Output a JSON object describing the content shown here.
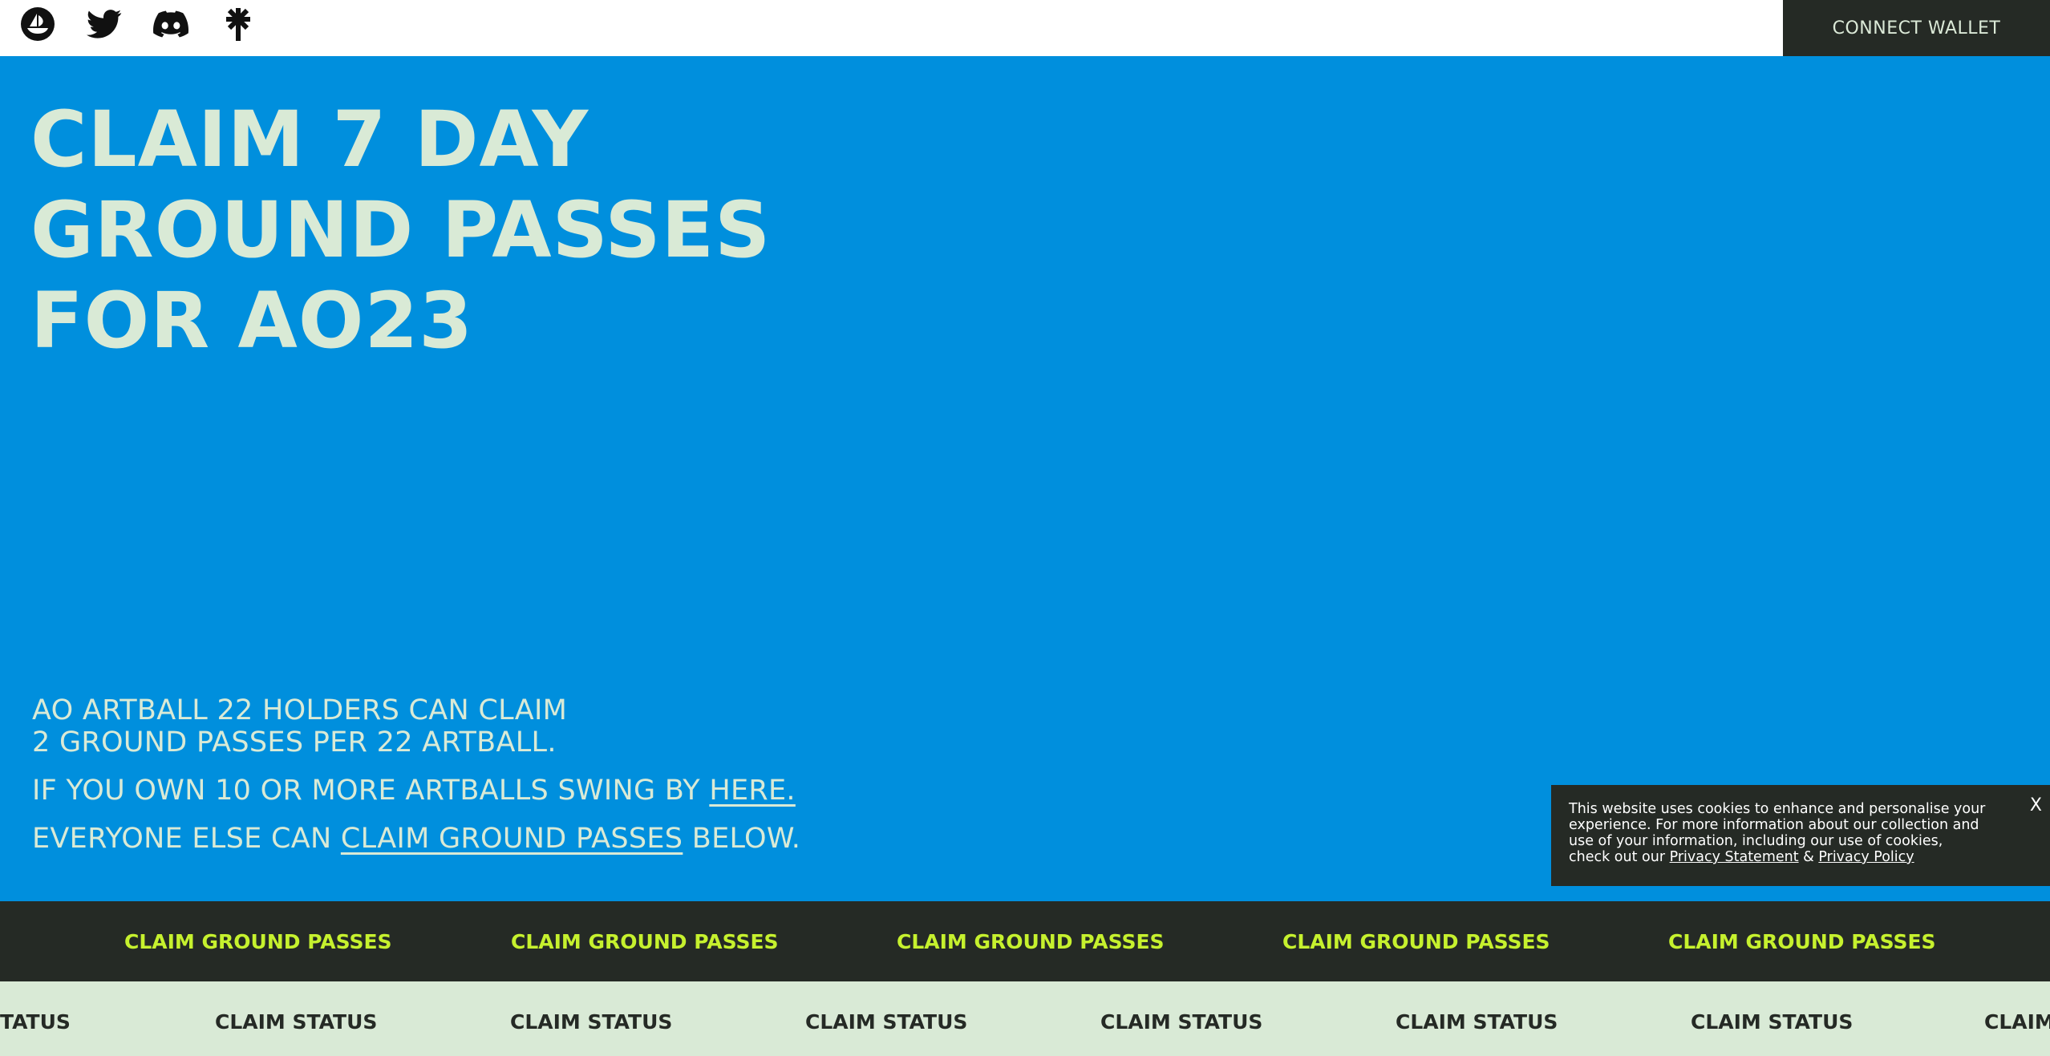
{
  "header": {
    "social_icons": [
      "opensea-icon",
      "twitter-icon",
      "discord-icon",
      "linktree-icon"
    ],
    "connect_label": "CONNECT WALLET"
  },
  "hero": {
    "title_lines": [
      "CLAIM 7 DAY",
      "GROUND PASSES",
      "FOR AO23"
    ]
  },
  "info": {
    "line1": "AO ARTBALL 22 HOLDERS CAN CLAIM",
    "line2": "2 GROUND PASSES PER 22 ARTBALL.",
    "line3_prefix": "IF YOU OWN 10 OR MORE ARTBALLS SWING BY ",
    "line3_link": "HERE.",
    "line4_prefix": "EVERYONE ELSE CAN ",
    "line4_link": "CLAIM GROUND PASSES",
    "line4_suffix": " BELOW."
  },
  "cookie": {
    "text": "This website uses cookies to enhance and personalise your experience. For more information about our collection and use of your information, including our use of cookies, check out our ",
    "privacy_statement": "Privacy Statement",
    "amp": " & ",
    "privacy_policy": "Privacy Policy",
    "close": "X"
  },
  "marquee_claim": [
    "CLAIM GROUND PASSES",
    "CLAIM GROUND PASSES",
    "CLAIM GROUND PASSES",
    "CLAIM GROUND PASSES",
    "CLAIM GROUND PASSES"
  ],
  "marquee_status": [
    "TATUS",
    "CLAIM STATUS",
    "CLAIM STATUS",
    "CLAIM STATUS",
    "CLAIM STATUS",
    "CLAIM STATUS",
    "CLAIM STATUS",
    "CLAIM"
  ],
  "colors": {
    "hero_bg": "#008fdd",
    "dark": "#252a25",
    "light": "#d9ead6",
    "accent": "#c6f12e"
  }
}
